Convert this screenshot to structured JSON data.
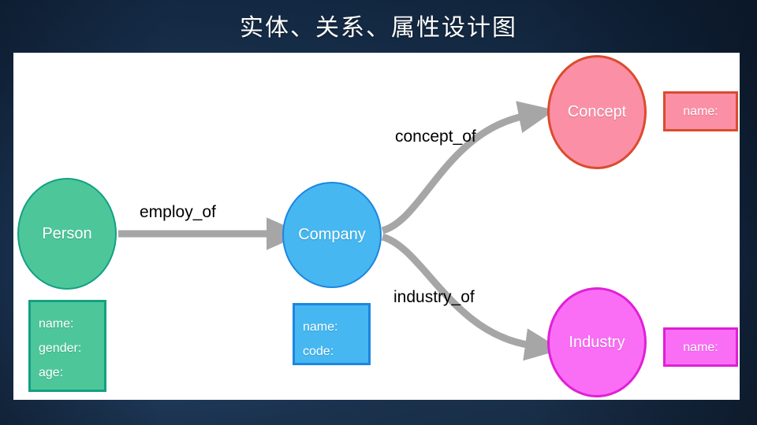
{
  "slide": {
    "title": "实体、关系、属性设计图",
    "background_top_color": "#0f2137",
    "background_mid_color": "#1a3252",
    "canvas_color": "#ffffff"
  },
  "diagram": {
    "nodes": [
      {
        "id": "person",
        "label": "Person",
        "fill": "#4DC79A",
        "stroke": "#13a083",
        "attributes": [
          "name:",
          "gender:",
          "age:"
        ]
      },
      {
        "id": "company",
        "label": "Company",
        "fill": "#46B7F0",
        "stroke": "#1C86E0",
        "attributes": [
          "name:",
          "code:"
        ]
      },
      {
        "id": "concept",
        "label": "Concept",
        "fill": "#FB8FA6",
        "stroke": "#DB4B2D",
        "attributes": [
          "name:"
        ]
      },
      {
        "id": "industry",
        "label": "Industry",
        "fill": "#FA6EF5",
        "stroke": "#E01FD6",
        "attributes": [
          "name:"
        ]
      }
    ],
    "edges": [
      {
        "id": "employ-of",
        "label": "employ_of",
        "from": "person",
        "to": "company",
        "color": "#A6A6A6"
      },
      {
        "id": "concept-of",
        "label": "concept_of",
        "from": "company",
        "to": "concept",
        "color": "#A6A6A6"
      },
      {
        "id": "industry-of",
        "label": "industry_of",
        "from": "company",
        "to": "industry",
        "color": "#A6A6A6"
      }
    ]
  }
}
